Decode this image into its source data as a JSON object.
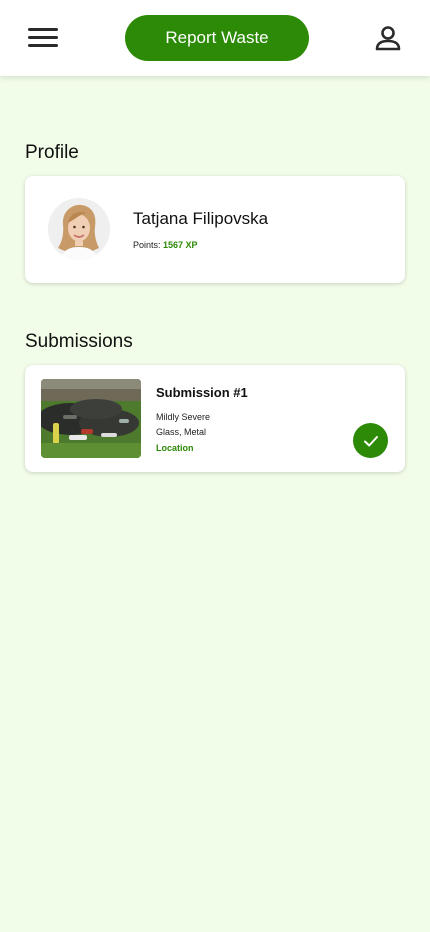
{
  "header": {
    "menu_icon": "hamburger-menu-icon",
    "report_button_label": "Report Waste",
    "user_icon": "user-icon"
  },
  "profile": {
    "section_title": "Profile",
    "name": "Tatjana Filipovska",
    "points_label": "Points:",
    "points_value": "1567 XP",
    "avatar": "user-avatar"
  },
  "submissions": {
    "section_title": "Submissions",
    "items": [
      {
        "title": "Submission #1",
        "severity": "Mildly Severe",
        "materials": "Glass, Metal",
        "location_label": "Location",
        "status_icon": "check-icon"
      }
    ]
  },
  "colors": {
    "accent": "#2d8a07",
    "background": "#f2fde9",
    "card": "#ffffff"
  }
}
